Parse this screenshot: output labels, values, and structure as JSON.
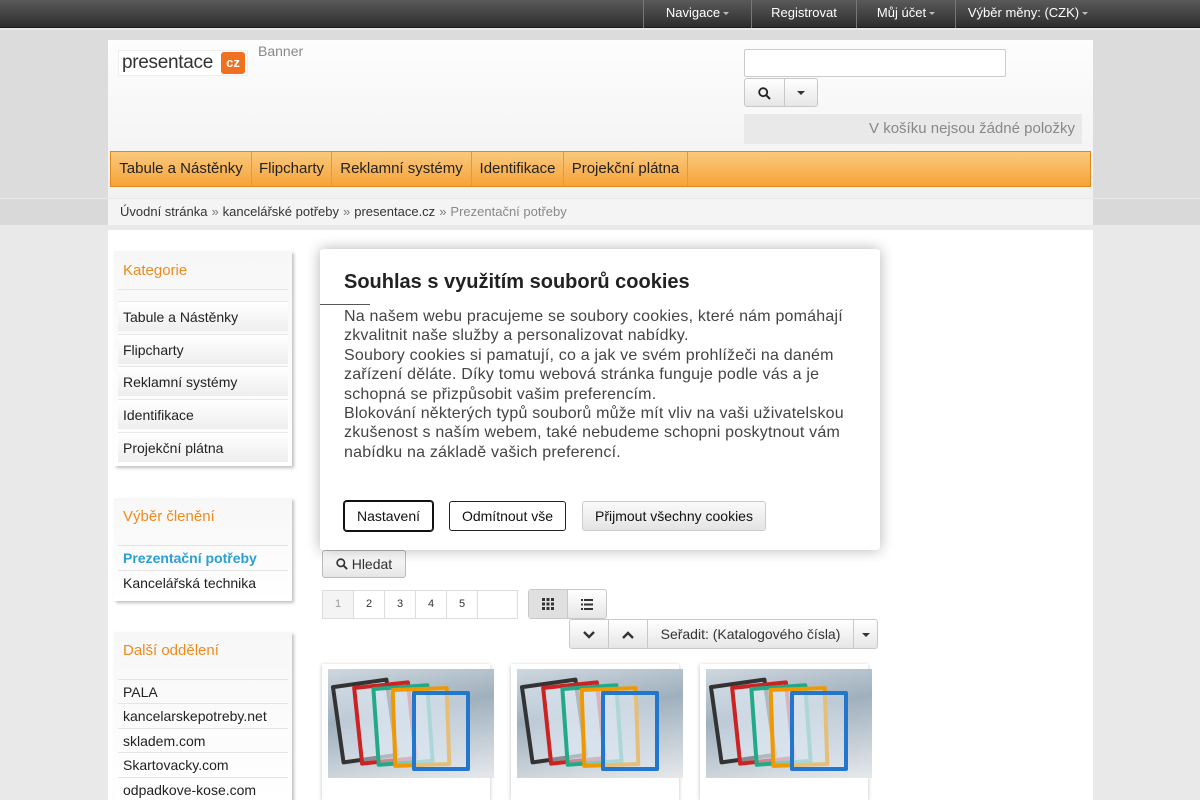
{
  "topbar": {
    "items": [
      "Navigace",
      "Registrovat",
      "Můj účet",
      "Výběr měny: (CZK)"
    ]
  },
  "header": {
    "logo_text": "presentace",
    "logo_mark": "cz",
    "banner": "Banner",
    "search_placeholder": "",
    "search_icon": "search-icon",
    "cart_text": "V košíku nejsou žádné položky"
  },
  "nav": {
    "items": [
      "Tabule a Nástěnky",
      "Flipcharty",
      "Reklamní systémy",
      "Identifikace",
      "Projekční plátna"
    ]
  },
  "breadcrumb": [
    "Úvodní stránka",
    "kancelářské potřeby",
    "presentace.cz",
    "Prezentační potřeby"
  ],
  "sidebar": {
    "categories_title": "Kategorie",
    "categories": [
      "Tabule a Nástěnky",
      "Flipcharty",
      "Reklamní systémy",
      "Identifikace",
      "Projekční plátna"
    ],
    "selection_title": "Výběr členění",
    "selection": [
      "Prezentační potřeby",
      "Kancelářská technika"
    ],
    "other_title": "Další oddělení",
    "other": [
      "PALA",
      "kancelarskepotreby.net",
      "skladem.com",
      "Skartovacky.com",
      "odpadkove-kose.com"
    ]
  },
  "cookie": {
    "title": "Souhlas s využitím souborů cookies",
    "paragraphs": [
      "Na našem webu pracujeme se soubory cookies, které nám pomáhají zkvalitnit naše služby a personalizovat nabídky.",
      "Soubory cookies si pamatují, co a jak ve svém prohlížeči na daném zařízení děláte. Díky tomu webová stránka funguje podle vás a je schopná se přizpůsobit vašim preferencím.",
      "Blokování některých typů souborů může mít vliv na vaši uživatelskou zkušenost s naším webem, také nebudeme schopni poskytnout vám nabídku na základě vašich preferencí."
    ],
    "btn_settings": "Nastavení",
    "btn_reject": "Odmítnout vše",
    "btn_accept": "Přijmout všechny cookies"
  },
  "products": {
    "search_button": "Hledat",
    "pages": [
      "1",
      "2",
      "3",
      "4",
      "5"
    ],
    "current_page": "1",
    "sort_label": "Seřadit: (Katalogového čísla)"
  },
  "colors": {
    "accent_orange": "#f08a1c",
    "nav_orange": "#f6a338",
    "selection_blue": "#2a9fd6"
  }
}
